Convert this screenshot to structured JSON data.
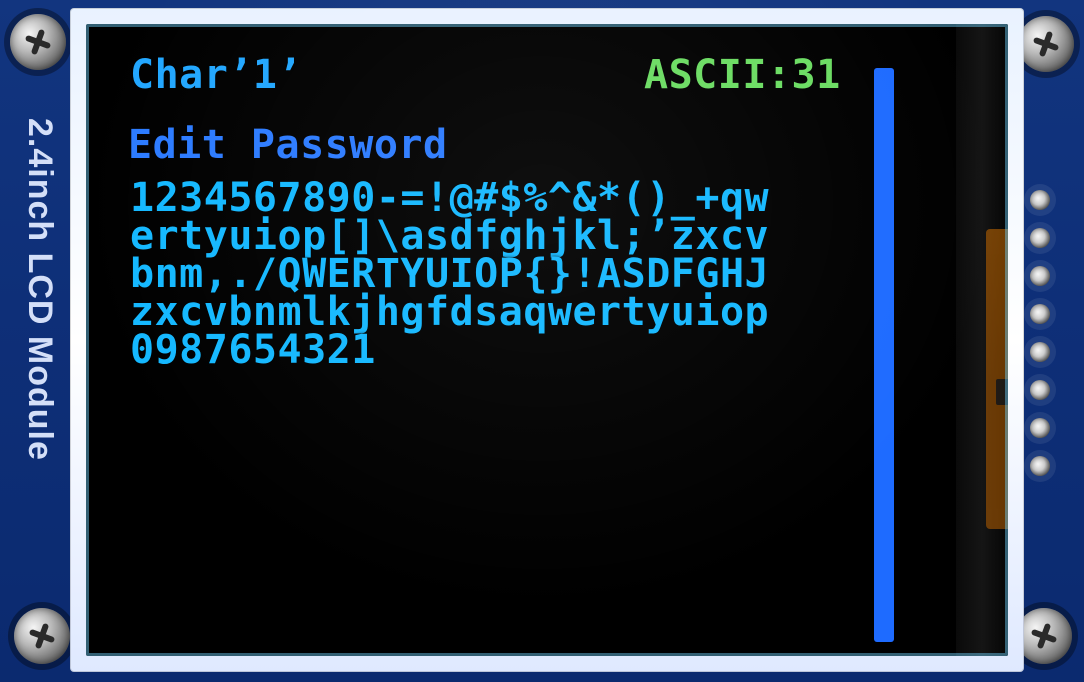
{
  "device": {
    "side_label": "2.4inch LCD Module"
  },
  "screen": {
    "top_left": "Char’1’",
    "top_right": "ASCII:31",
    "title": "Edit Password",
    "password_lines": [
      "1234567890-=!@#$%^&*()_+qw",
      "ertyuiop[]\\asdfghjkl;’zxcv",
      "bnm,./QWERTYUIOP{}!ASDFGHJ",
      "zxcvbnmlkjhgfdsaqwertyuiop",
      "0987654321"
    ],
    "progress_fraction": 1.0
  },
  "colors": {
    "pcb_blue": "#0b2a74",
    "text_blue": "#14b8ff",
    "title_blue": "#2c7bff",
    "ascii_green": "#6bdc62",
    "progress_blue": "#1e6bff"
  },
  "icons": {
    "screw_icon": "screw-icon",
    "pin_icon": "pin-icon"
  }
}
